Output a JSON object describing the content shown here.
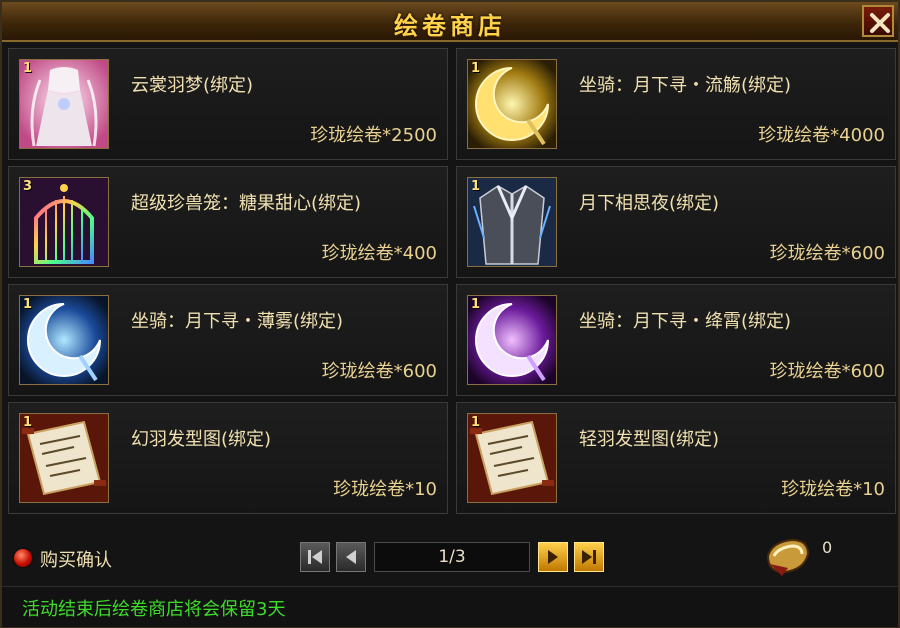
{
  "window": {
    "title": "绘卷商店",
    "close_icon": "close-icon"
  },
  "items": [
    {
      "qty": "1",
      "name": "云裳羽梦(绑定)",
      "price": "珍珑绘卷*2500",
      "icon": "costume-icon"
    },
    {
      "qty": "1",
      "name": "坐骑：月下寻・流觞(绑定)",
      "price": "珍珑绘卷*4000",
      "icon": "moon-mount-gold-icon"
    },
    {
      "qty": "3",
      "name": "超级珍兽笼：糖果甜心(绑定)",
      "price": "珍珑绘卷*400",
      "icon": "pet-cage-icon"
    },
    {
      "qty": "1",
      "name": "月下相思夜(绑定)",
      "price": "珍珑绘卷*600",
      "icon": "robe-icon"
    },
    {
      "qty": "1",
      "name": "坐骑：月下寻・薄雾(绑定)",
      "price": "珍珑绘卷*600",
      "icon": "moon-mount-blue-icon"
    },
    {
      "qty": "1",
      "name": "坐骑：月下寻・绛霄(绑定)",
      "price": "珍珑绘卷*600",
      "icon": "moon-mount-purple-icon"
    },
    {
      "qty": "1",
      "name": "幻羽发型图(绑定)",
      "price": "珍珑绘卷*10",
      "icon": "hairstyle-scroll-icon"
    },
    {
      "qty": "1",
      "name": "轻羽发型图(绑定)",
      "price": "珍珑绘卷*10",
      "icon": "hairstyle-scroll-icon"
    }
  ],
  "purchase_confirm": {
    "label": "购买确认"
  },
  "pagination": {
    "page": "1/3"
  },
  "currency": {
    "count": "0",
    "icon": "scroll-currency-icon"
  },
  "footer": {
    "notice": "活动结束后绘卷商店将会保留3天"
  },
  "colors": {
    "title": "#ffd24a",
    "item_text": "#f0e0b0",
    "notice": "#3ddc2a",
    "frame": "#3a2e1c"
  }
}
